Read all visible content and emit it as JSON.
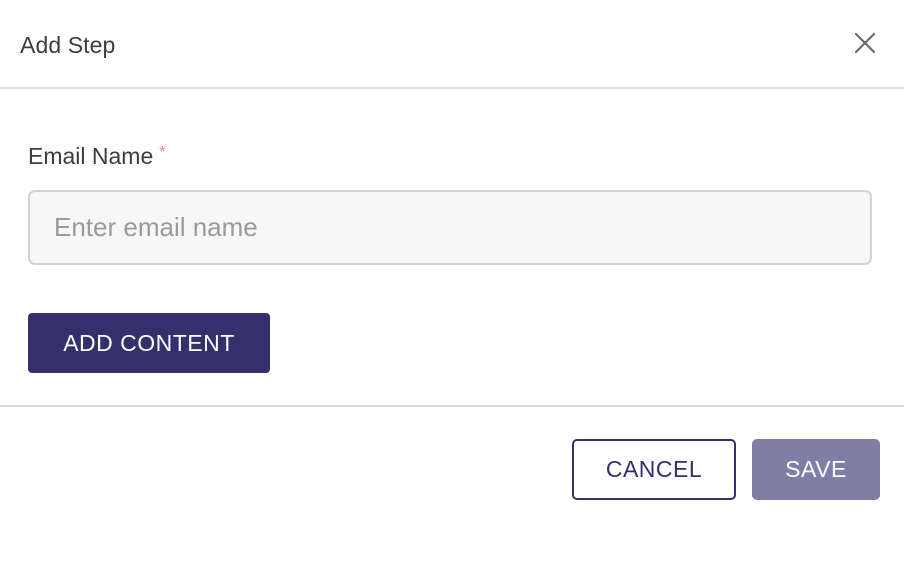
{
  "dialog": {
    "title": "Add Step",
    "close_icon": "close-icon"
  },
  "form": {
    "email_name_label": "Email Name",
    "required_marker": "*",
    "email_name_value": "",
    "email_name_placeholder": "Enter email name",
    "add_content_label": "ADD CONTENT"
  },
  "footer": {
    "cancel_label": "CANCEL",
    "save_label": "SAVE"
  },
  "colors": {
    "primary": "#352f6c",
    "save_disabled": "#807ea6",
    "required": "#f08080",
    "divider": "#dcdce3"
  }
}
